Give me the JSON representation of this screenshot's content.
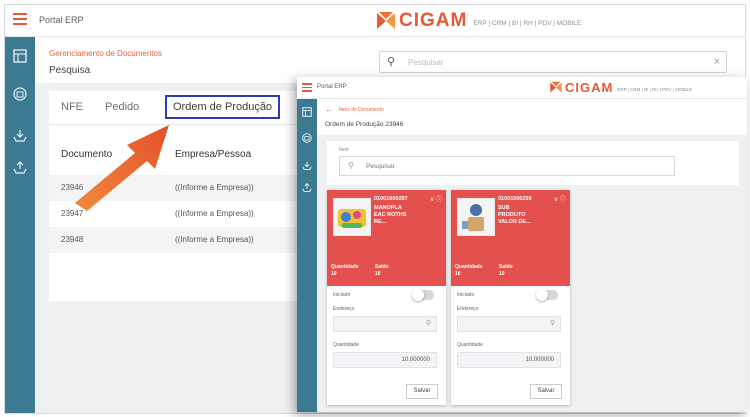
{
  "app": {
    "title": "Portal ERP",
    "brand": "CIGAM",
    "tagline": "ERP | CRM | BI | RH | PDV | MOBILE"
  },
  "colors": {
    "accent": "#e45a35",
    "sidebar": "#3b7a90",
    "card_red": "#e4504e",
    "tab_highlight": "#2a3eb1"
  },
  "sidebar_icons": [
    "dashboard-icon",
    "building-icon",
    "cart-down-icon",
    "cart-up-icon"
  ],
  "header": {
    "breadcrumb": "Gerenciamento de Documentos",
    "page_title": "Pesquisa",
    "search_placeholder": "Pesquisar"
  },
  "tabs": [
    {
      "label": "NFE"
    },
    {
      "label": "Pedido"
    },
    {
      "label": "Ordem de Produção",
      "active": true
    }
  ],
  "table": {
    "columns": [
      "Documento",
      "Empresa/Pessoa"
    ],
    "rows": [
      [
        "23946",
        "((Informe a Empresa))"
      ],
      [
        "23947",
        "((Informe a Empresa))"
      ],
      [
        "23948",
        "((Informe a Empresa))"
      ]
    ]
  },
  "overlay": {
    "app_title": "Portal ERP",
    "brand": "CIGAM",
    "tagline": "ERP | CRM | BI | RH | PDV | MOBILE",
    "breadcrumb": "Itens do Documento",
    "page_title": "Ordem de Produção 23946",
    "filter_label": "Item",
    "search_placeholder": "Pesquisar",
    "cards": [
      {
        "code": "01001000297",
        "name_lines": [
          "MANOPLA",
          "EAC ROTHS",
          "RE..."
        ],
        "qty_label": "Quantidade",
        "qty": "10",
        "saldo_label": "Saldo",
        "saldo": "10",
        "iniciado_label": "Iniciado",
        "endereco_label": "Endereço",
        "quantidade_label": "Quantidade",
        "quantidade_value": "10,000000",
        "save_label": "Salvar"
      },
      {
        "code": "01001000299",
        "name_lines": [
          "SUB",
          "PRODUTO",
          "VALOR DE..."
        ],
        "qty_label": "Quantidade",
        "qty": "10",
        "saldo_label": "Saldo",
        "saldo": "10",
        "iniciado_label": "Iniciado",
        "endereco_label": "Endereço",
        "quantidade_label": "Quantidade",
        "quantidade_value": "10,000000",
        "save_label": "Salvar"
      }
    ]
  }
}
